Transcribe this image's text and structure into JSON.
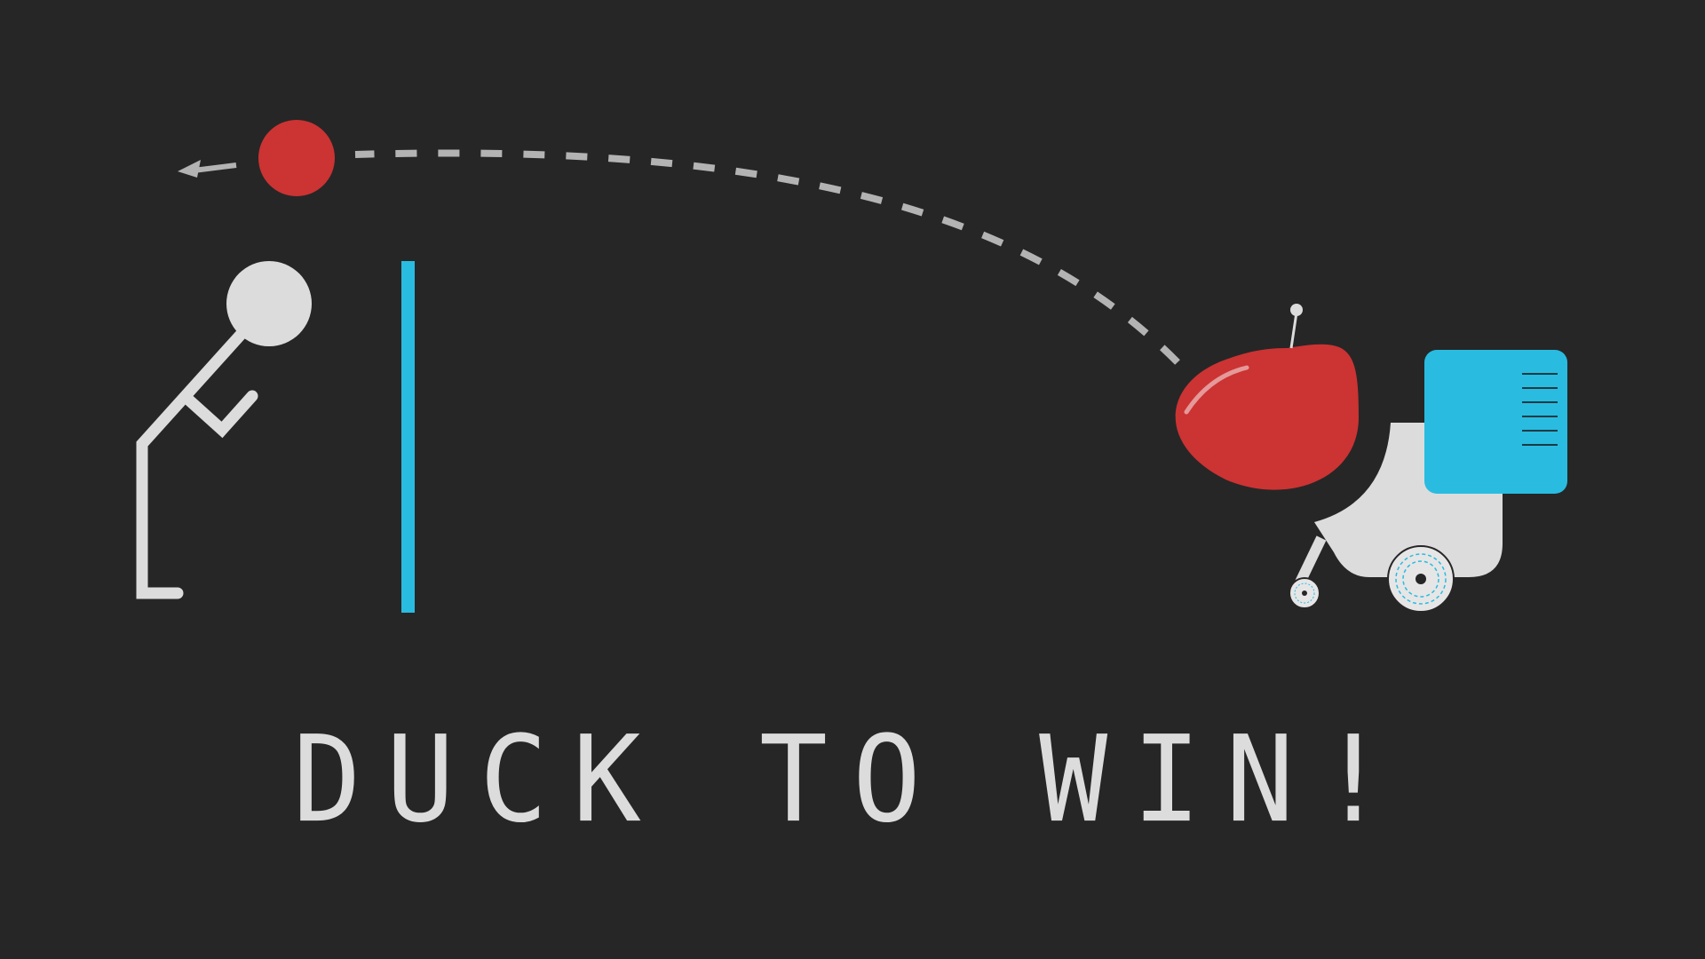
{
  "game": {
    "title": "DUCK TO WIN!"
  },
  "colors": {
    "background": "#262626",
    "figure": "#dcdcdc",
    "ball": "#cc3333",
    "barrier": "#29bce0",
    "trajectory": "#b3b3b3",
    "launcher_body": "#dcdcdc",
    "launcher_head": "#cc3333",
    "launcher_panel": "#29bce0"
  }
}
